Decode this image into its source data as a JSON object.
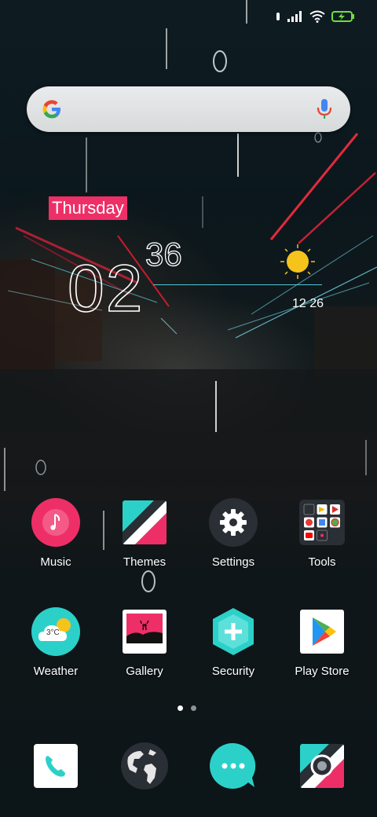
{
  "status_bar": {
    "icons": [
      "alarm-icon",
      "signal-icon",
      "wifi-icon",
      "battery-charging-icon"
    ]
  },
  "search": {
    "provider_icon": "google-g-icon",
    "voice_icon": "microphone-icon"
  },
  "clock_widget": {
    "day": "Thursday",
    "hour": "02",
    "minute": "36",
    "weather_icon": "sun-icon",
    "weather_time": "12 26"
  },
  "apps": [
    {
      "label": "Music",
      "icon": "music-icon"
    },
    {
      "label": "Themes",
      "icon": "themes-icon"
    },
    {
      "label": "Settings",
      "icon": "gear-icon"
    },
    {
      "label": "Tools",
      "icon": "tools-folder-icon"
    },
    {
      "label": "Weather",
      "icon": "weather-icon",
      "icon_text": "3°C"
    },
    {
      "label": "Gallery",
      "icon": "gallery-icon"
    },
    {
      "label": "Security",
      "icon": "security-icon"
    },
    {
      "label": "Play Store",
      "icon": "play-store-icon"
    }
  ],
  "page_indicator": {
    "pages": 2,
    "current": 1
  },
  "dock": [
    {
      "icon": "phone-icon"
    },
    {
      "icon": "browser-globe-icon"
    },
    {
      "icon": "messages-icon"
    },
    {
      "icon": "camera-icon"
    }
  ],
  "colors": {
    "accent_pink": "#ee2f67",
    "accent_teal": "#2bd1c9",
    "dark_icon_bg": "#2a2e35"
  }
}
